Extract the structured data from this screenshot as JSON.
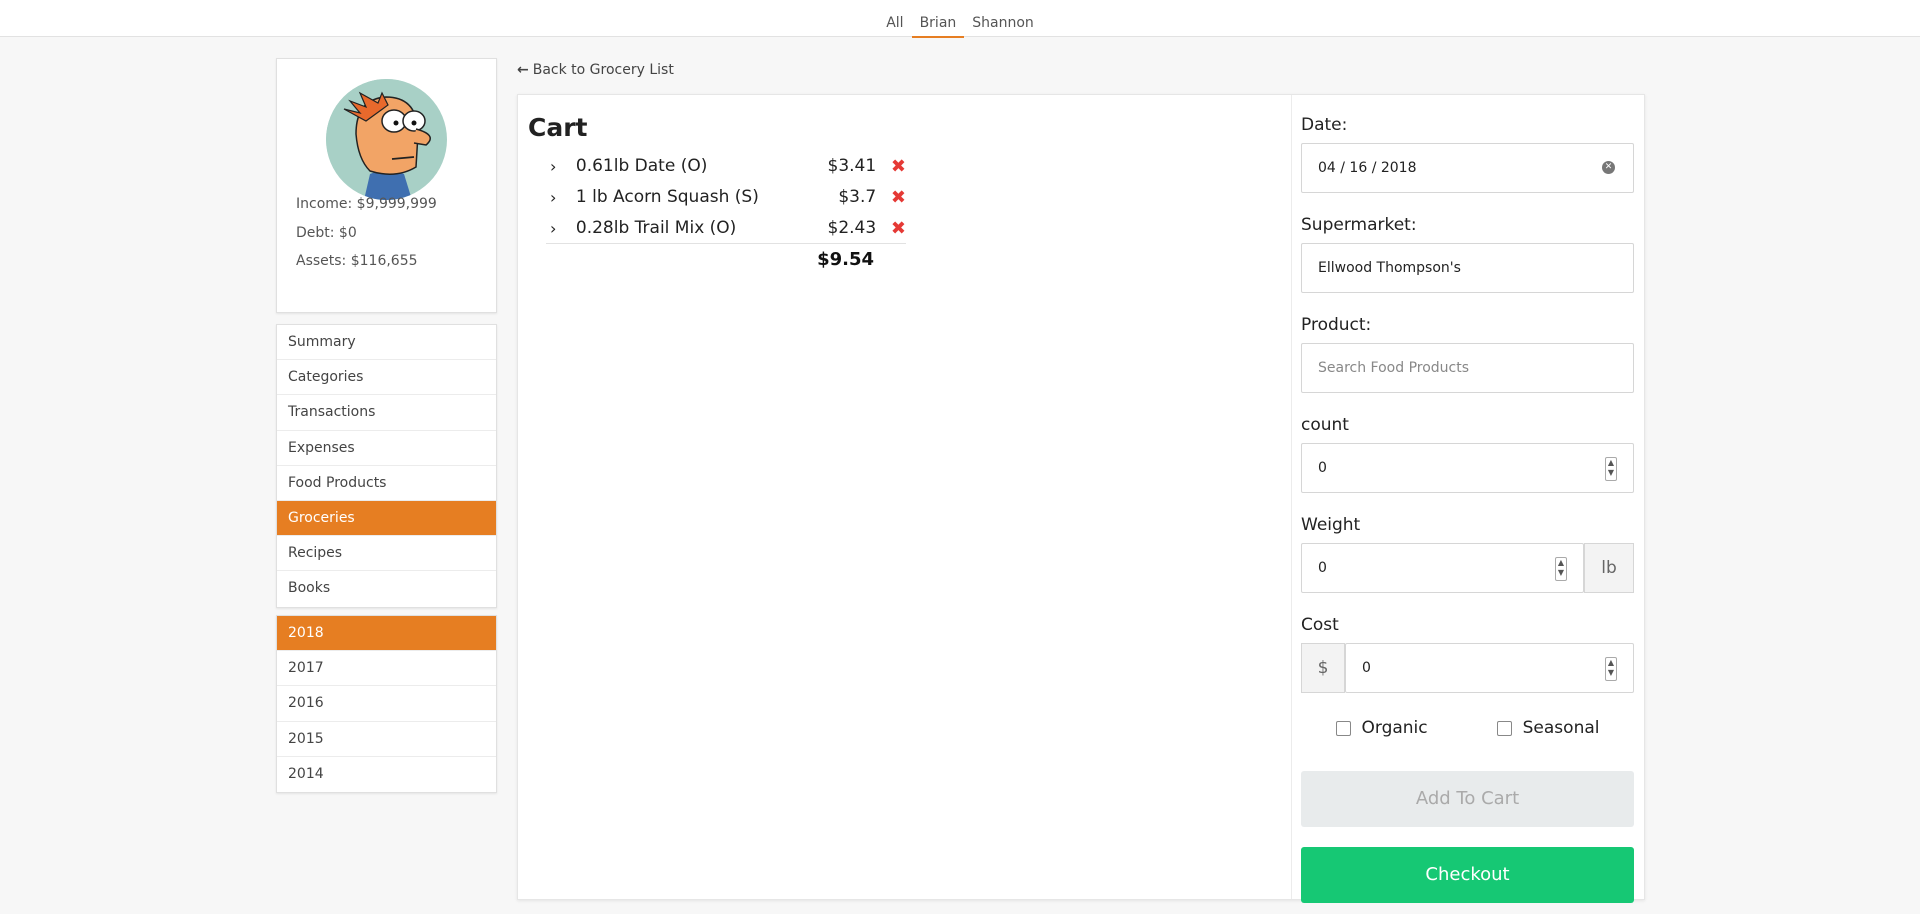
{
  "topnav": {
    "tabs": [
      "All",
      "Brian",
      "Shannon"
    ],
    "active": "Brian"
  },
  "profile": {
    "income": "Income: $9,999,999",
    "debt": "Debt: $0",
    "assets": "Assets: $116,655"
  },
  "menu": {
    "items": [
      "Summary",
      "Categories",
      "Transactions",
      "Expenses",
      "Food Products",
      "Groceries",
      "Recipes",
      "Books"
    ],
    "active": "Groceries"
  },
  "years": {
    "items": [
      "2018",
      "2017",
      "2016",
      "2015",
      "2014"
    ],
    "active": "2018"
  },
  "back_link": "Back to Grocery List",
  "cart": {
    "title": "Cart",
    "items": [
      {
        "name": "0.61lb Date (O)",
        "price": "$3.41"
      },
      {
        "name": "1 lb Acorn Squash (S)",
        "price": "$3.7"
      },
      {
        "name": "0.28lb Trail Mix (O)",
        "price": "$2.43"
      }
    ],
    "total": "$9.54"
  },
  "form": {
    "date_label": "Date:",
    "date_value": "04 / 16 / 2018",
    "supermarket_label": "Supermarket:",
    "supermarket_value": "Ellwood Thompson's",
    "product_label": "Product:",
    "product_placeholder": "Search Food Products",
    "count_label": "count",
    "count_value": "0",
    "weight_label": "Weight",
    "weight_value": "0",
    "weight_unit": "lb",
    "cost_label": "Cost",
    "cost_prefix": "$",
    "cost_value": "0",
    "organic_label": "Organic",
    "seasonal_label": "Seasonal",
    "add_button": "Add To Cart",
    "checkout_button": "Checkout"
  },
  "colors": {
    "accent": "#e67e22",
    "checkout": "#16c874",
    "delete": "#e53935"
  }
}
